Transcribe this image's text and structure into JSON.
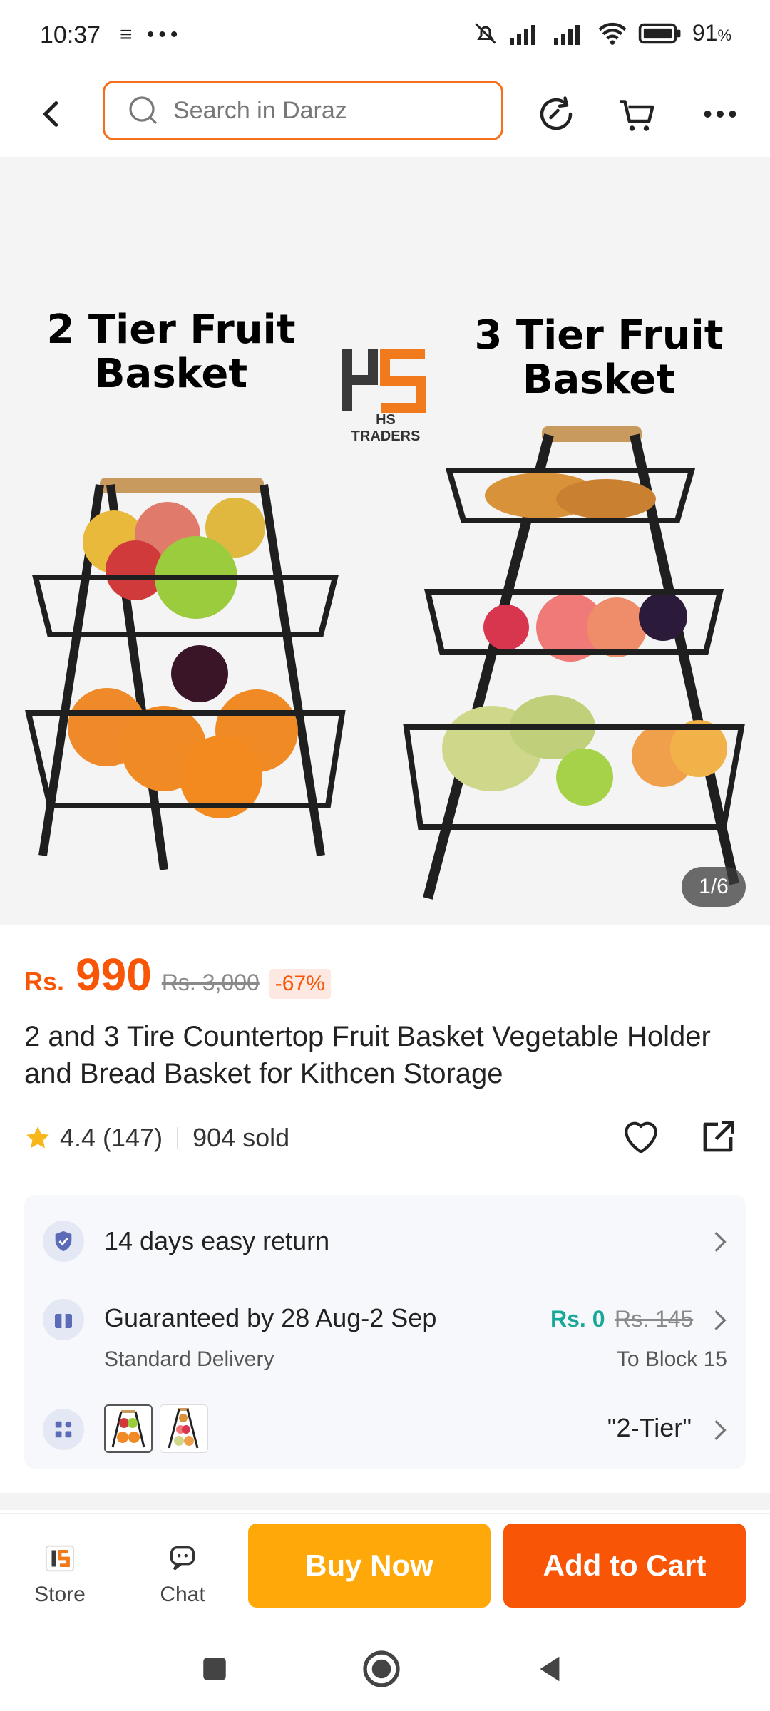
{
  "status_bar": {
    "time": "10:37",
    "left_icons": "≡ •••",
    "battery": "91"
  },
  "header": {
    "search_placeholder": "Search in Daraz"
  },
  "gallery": {
    "left_title": "2 Tier Fruit Basket",
    "right_title": "3 Tier Fruit Basket",
    "brand": "HS TRADERS",
    "counter": "1/6"
  },
  "product": {
    "currency": "Rs.",
    "price": "990",
    "original_price": "Rs. 3,000",
    "discount": "-67%",
    "title": "2 and 3 Tire Countertop Fruit Basket Vegetable Holder and Bread Basket for Kithcen Storage",
    "rating": "4.4",
    "reviews": "(147)",
    "sold": "904 sold"
  },
  "services": {
    "return_text": "14 days easy return",
    "delivery_text": "Guaranteed by 28 Aug-2 Sep",
    "delivery_type": "Standard Delivery",
    "fee_free": "Rs. 0",
    "fee_original": "Rs. 145",
    "destination": "To Block 15",
    "variant_selected": "\"2-Tier\""
  },
  "bottom_bar": {
    "store_label": "Store",
    "chat_label": "Chat",
    "buy_now": "Buy Now",
    "add_to_cart": "Add to Cart"
  },
  "colors": {
    "accent": "#f85606",
    "buy_now": "#fea80a",
    "free_fee": "#18a89a"
  }
}
